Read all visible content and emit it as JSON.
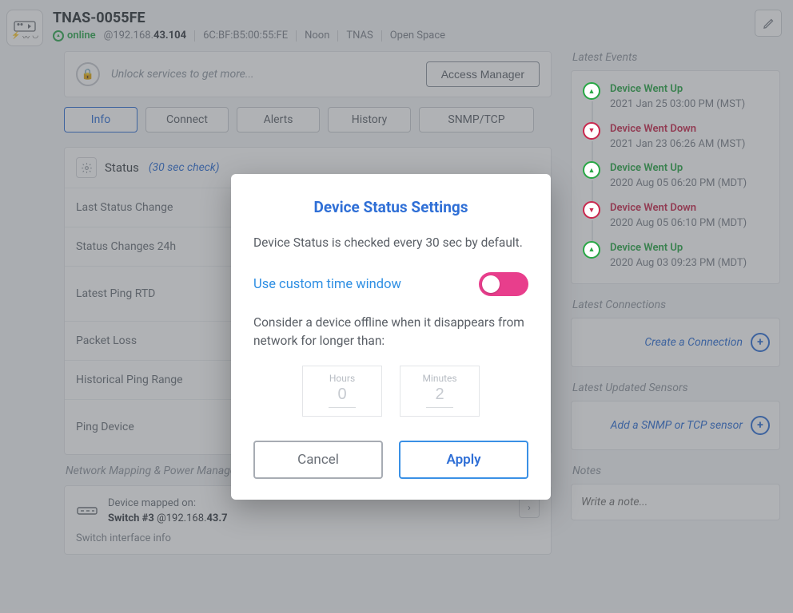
{
  "header": {
    "device_name": "TNAS-0055FE",
    "status_word": "online",
    "ip_prefix": "@192.168.",
    "ip_bold": "43.104",
    "mac": "6C:BF:B5:00:55:FE",
    "meta1": "Noon",
    "meta2": "TNAS",
    "meta3": "Open Space"
  },
  "unlock": {
    "text": "Unlock services to get more...",
    "button": "Access Manager"
  },
  "tabs": {
    "info": "Info",
    "connect": "Connect",
    "alerts": "Alerts",
    "history": "History",
    "snmp": "SNMP/TCP"
  },
  "status_card": {
    "title": "Status",
    "sub": "(30 sec check)",
    "rows": {
      "last_change": "Last Status Change",
      "changes24": "Status Changes 24h",
      "latest_ping": "Latest Ping RTD",
      "packet_loss": "Packet Loss",
      "hist_range": "Historical Ping Range",
      "ping_device": "Ping Device"
    }
  },
  "mapping": {
    "section": "Network Mapping & Power Management",
    "label": "Device mapped on:",
    "switch_name": "Switch #3",
    "switch_ip_prefix": " @192.168.",
    "switch_ip_bold": "43.7",
    "sub": "Switch interface info"
  },
  "events": {
    "section": "Latest Events",
    "items": [
      {
        "kind": "up",
        "title": "Device Went Up",
        "time": "2021 Jan 25 03:00 PM (MST)"
      },
      {
        "kind": "down",
        "title": "Device Went Down",
        "time": "2021 Jan 23 06:26 AM (MST)"
      },
      {
        "kind": "up",
        "title": "Device Went Up",
        "time": "2020 Aug 05 06:20 PM (MDT)"
      },
      {
        "kind": "down",
        "title": "Device Went Down",
        "time": "2020 Aug 05 06:10 PM (MDT)"
      },
      {
        "kind": "up",
        "title": "Device Went Up",
        "time": "2020 Aug 03 09:23 PM (MDT)"
      }
    ]
  },
  "connections": {
    "section": "Latest Connections",
    "cta": "Create a Connection"
  },
  "sensors": {
    "section": "Latest Updated Sensors",
    "cta": "Add a SNMP or TCP sensor"
  },
  "notes": {
    "section": "Notes",
    "placeholder": "Write a note..."
  },
  "modal": {
    "title": "Device Status Settings",
    "desc": "Device Status is checked every 30 sec by default.",
    "toggle_label": "Use custom time window",
    "sub": "Consider a device offline when it disappears from network for longer than:",
    "hours_label": "Hours",
    "hours_value": "0",
    "minutes_label": "Minutes",
    "minutes_value": "2",
    "cancel": "Cancel",
    "apply": "Apply"
  }
}
